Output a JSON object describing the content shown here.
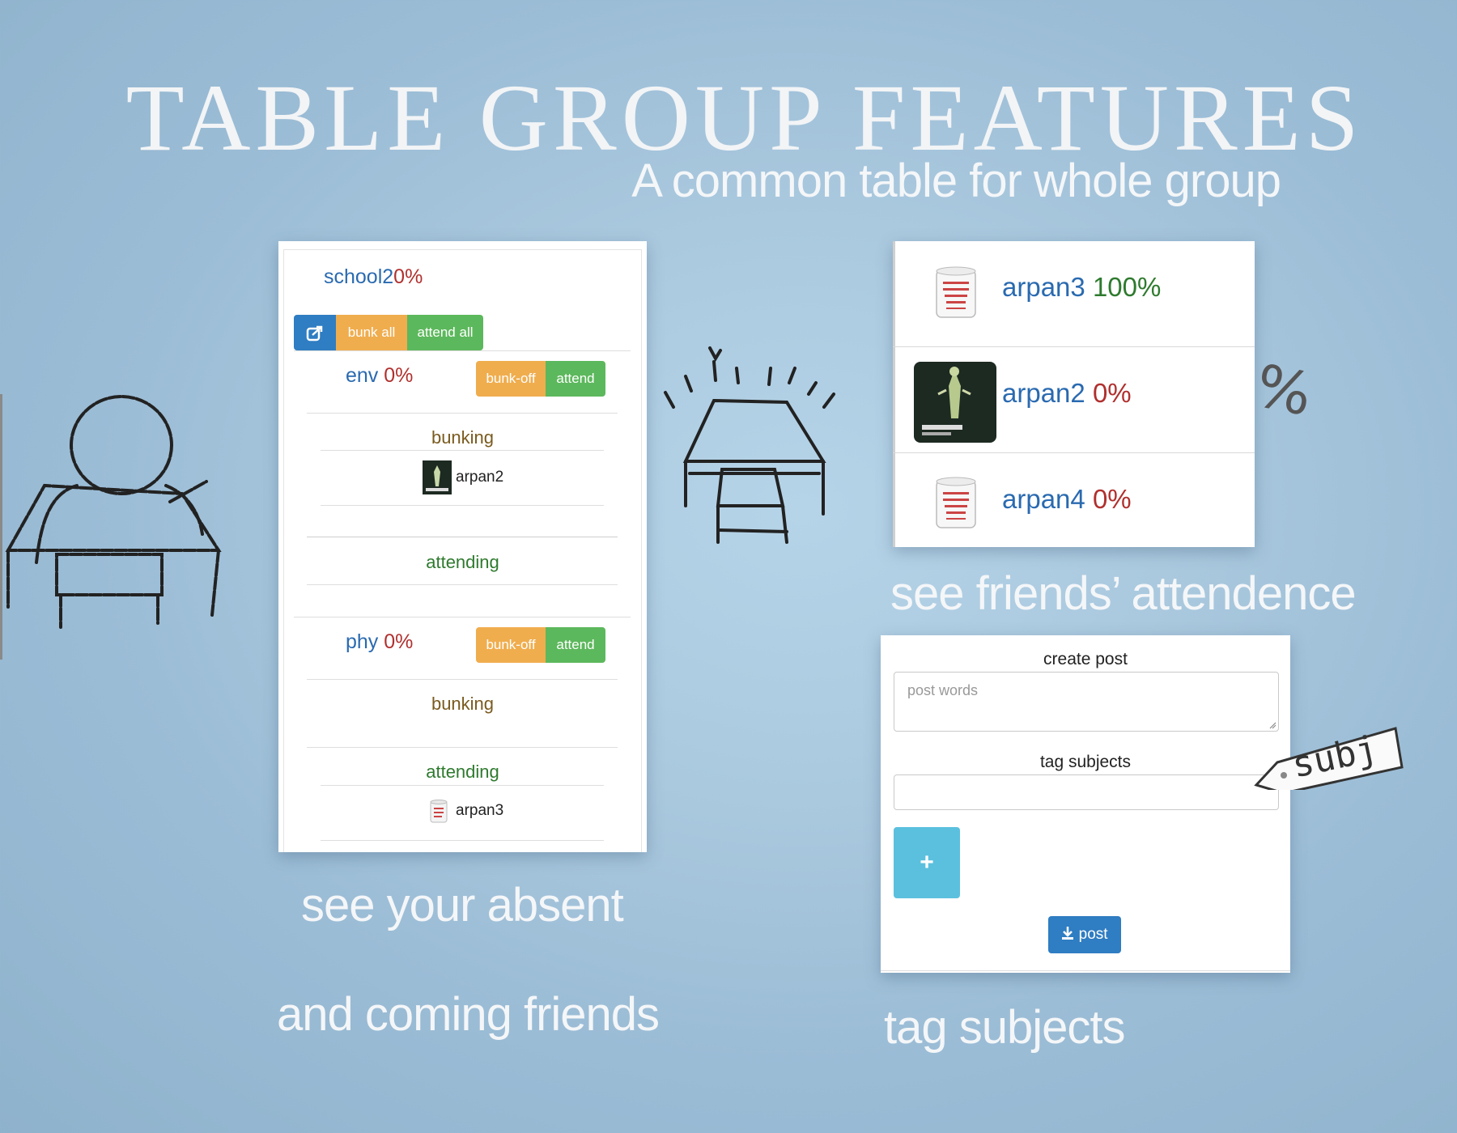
{
  "header": {
    "title": "TABLE GROUP FEATURES",
    "subtitle": "A common table for whole group"
  },
  "captions": {
    "absent_line1": "see your absent",
    "absent_line2": "and coming friends",
    "friends": "see friends’ attendence",
    "tag": "tag subjects"
  },
  "decor": {
    "percent_sketch": "%",
    "tag_sketch": "subj"
  },
  "attendance_card": {
    "group_name": "school2",
    "group_percent": "0%",
    "bunk_all_label": "bunk all",
    "attend_all_label": "attend all",
    "subjects": [
      {
        "name": "env",
        "percent": "0%",
        "bunk_off_label": "bunk-off",
        "attend_label": "attend",
        "bunking_label": "bunking",
        "bunking_users": [
          "arpan2"
        ],
        "attending_label": "attending",
        "attending_users": []
      },
      {
        "name": "phy",
        "percent": "0%",
        "bunk_off_label": "bunk-off",
        "attend_label": "attend",
        "bunking_label": "bunking",
        "bunking_users": [],
        "attending_label": "attending",
        "attending_users": [
          "arpan3"
        ]
      }
    ]
  },
  "friends_card": {
    "friends": [
      {
        "name": "arpan3",
        "percent": "100%",
        "avatar": "mug-avatar"
      },
      {
        "name": "arpan2",
        "percent": "0%",
        "avatar": "game-poster-avatar"
      },
      {
        "name": "arpan4",
        "percent": "0%",
        "avatar": "mug-avatar"
      }
    ]
  },
  "post_card": {
    "create_post_label": "create post",
    "post_placeholder": "post words",
    "tag_subjects_label": "tag subjects",
    "tag_input_value": "",
    "plus_label": "+",
    "post_button_label": "post"
  },
  "colors": {
    "blue": "#2a6ab0",
    "red": "#b0302e",
    "green": "#2e7a2e",
    "orange": "#f0ad4e",
    "btn_green": "#5cb85c",
    "info": "#5bc0de",
    "primary": "#2f7dc2"
  }
}
